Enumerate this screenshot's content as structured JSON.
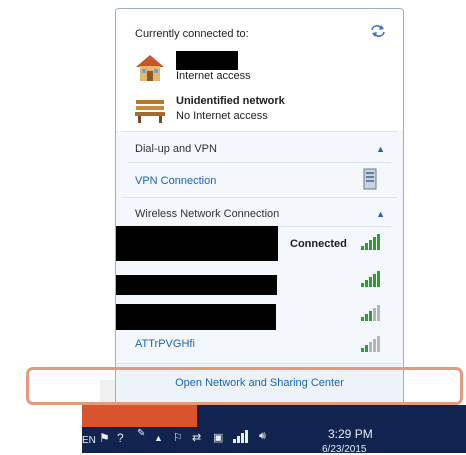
{
  "flyout": {
    "currently_connected": "Currently connected to:",
    "networks": [
      {
        "name": "",
        "status": "Internet access"
      },
      {
        "name": "Unidentified network",
        "status": "No Internet access"
      }
    ],
    "dialup": {
      "title": "Dial-up and VPN",
      "items": [
        {
          "label": "VPN Connection"
        }
      ]
    },
    "wireless": {
      "title": "Wireless Network Connection",
      "items": [
        {
          "ssid": "",
          "status": "Connected",
          "signal": 5
        },
        {
          "ssid": "",
          "status": "",
          "signal": 5
        },
        {
          "ssid": "",
          "status": "",
          "signal": 3
        },
        {
          "ssid": "ATTrPVGHfi",
          "status": "",
          "signal": 2
        }
      ]
    },
    "footer_link": "Open Network and Sharing Center"
  },
  "taskbar": {
    "language": "EN",
    "time": "3:29 PM",
    "date": "6/23/2015"
  },
  "colors": {
    "link": "#1a64c6",
    "highlight": "#e59a7b",
    "taskbar": "#10244f",
    "signal_on": "#2f9e2f"
  }
}
